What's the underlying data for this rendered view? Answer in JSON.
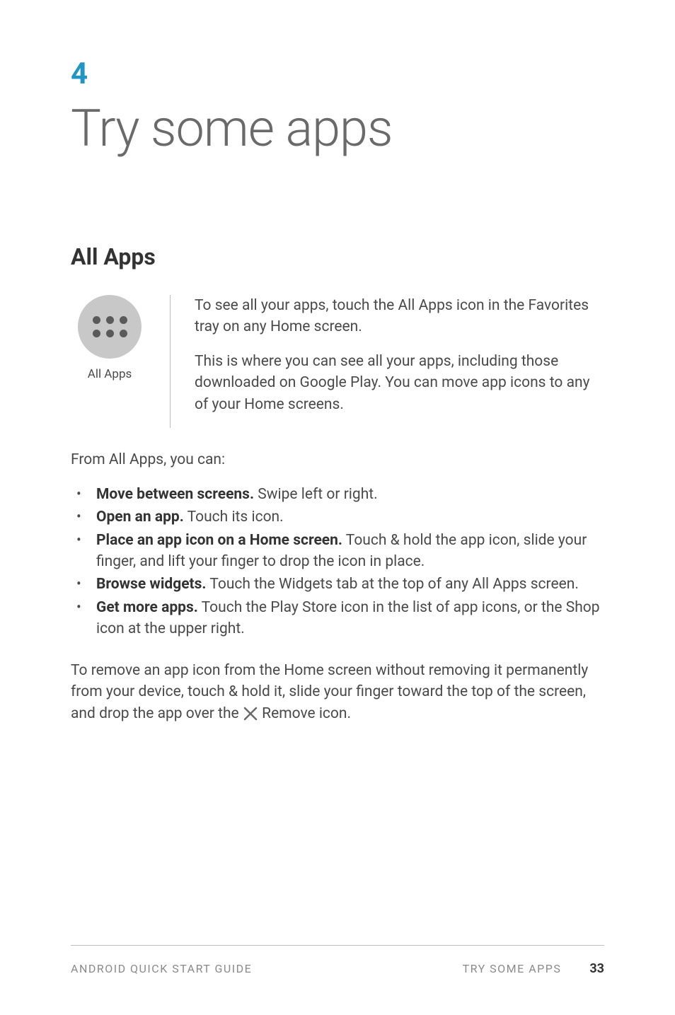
{
  "chapter": {
    "number": "4",
    "title": "Try some apps"
  },
  "section": {
    "title": "All Apps"
  },
  "icon_block": {
    "label": "All Apps",
    "intro_p1": "To see all your apps, touch the All Apps icon in the Favorites tray on any Home screen.",
    "intro_p2": "This is where you can see all your apps, including those downloaded on Google Play. You can move app icons to any of your Home screens."
  },
  "body": {
    "lead": "From All Apps, you can:",
    "bullets": [
      {
        "strong": "Move between screens.",
        "rest": " Swipe left or right."
      },
      {
        "strong": "Open an app.",
        "rest": " Touch its icon."
      },
      {
        "strong": "Place an app icon on a Home screen.",
        "rest": " Touch & hold the app icon, slide your finger, and lift your finger to drop the icon in place."
      },
      {
        "strong": "Browse widgets.",
        "rest": " Touch the Widgets tab at the top of any All Apps screen."
      },
      {
        "strong": "Get more apps.",
        "rest": " Touch the Play Store icon in the list of app icons, or the Shop icon at the upper right."
      }
    ],
    "remove_para_before": "To remove an app icon from the Home screen without remov­ing it permanently from your device, touch & hold it, slide your finger toward the top of the screen, and drop the app over the ",
    "remove_para_after": " Remove icon."
  },
  "footer": {
    "left": "ANDROID QUICK START GUIDE",
    "center": "TRY SOME APPS",
    "page": "33"
  }
}
